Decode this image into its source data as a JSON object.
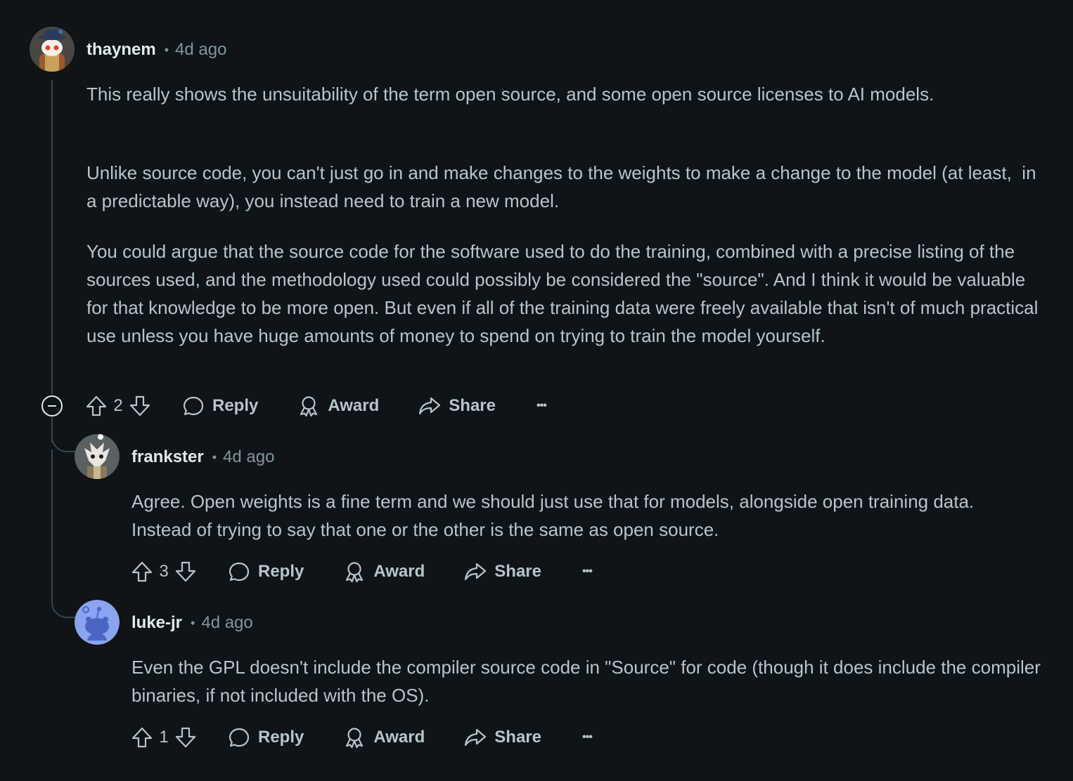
{
  "comments": [
    {
      "username": "thaynem",
      "time": "4d ago",
      "paragraphs": [
        "This really shows the unsuitability of the term open source, and some open source licenses to AI models.",
        "Unlike source code, you can't just go in and make changes to the weights to make a change to the model (at least,  in a predictable way), you instead need to train a new model.",
        "You could argue that the source code for the software used to do the training, combined with a precise listing of the sources used, and the methodology used could possibly be considered the \"source\". And I think it would be valuable for that knowledge to be more open. But even if all of the training data were freely available that isn't of much practical use unless you have huge amounts of money to spend on trying to train the model yourself."
      ],
      "votes": "2"
    },
    {
      "username": "frankster",
      "time": "4d ago",
      "paragraphs": [
        "Agree. Open weights is a fine term and we should just use that for models, alongside open training data. Instead of trying to say that one or the other is the same as open source."
      ],
      "votes": "3"
    },
    {
      "username": "luke-jr",
      "time": "4d ago",
      "paragraphs": [
        "Even the GPL doesn't include the compiler source code in \"Source\" for code (though it does include the compiler binaries, if not included with the OS)."
      ],
      "votes": "1"
    }
  ],
  "labels": {
    "separator": "•",
    "reply": "Reply",
    "award": "Award",
    "share": "Share",
    "more": "•••"
  },
  "icons": [
    "upvote-icon",
    "downvote-icon",
    "reply-bubble-icon",
    "award-icon",
    "share-arrow-icon",
    "more-dots-icon",
    "collapse-icon"
  ],
  "colors": {
    "background": "#0e1418",
    "text": "#b7c5cc",
    "username": "#e3eaed",
    "muted": "#82959e",
    "thread_line": "#3a454b"
  }
}
